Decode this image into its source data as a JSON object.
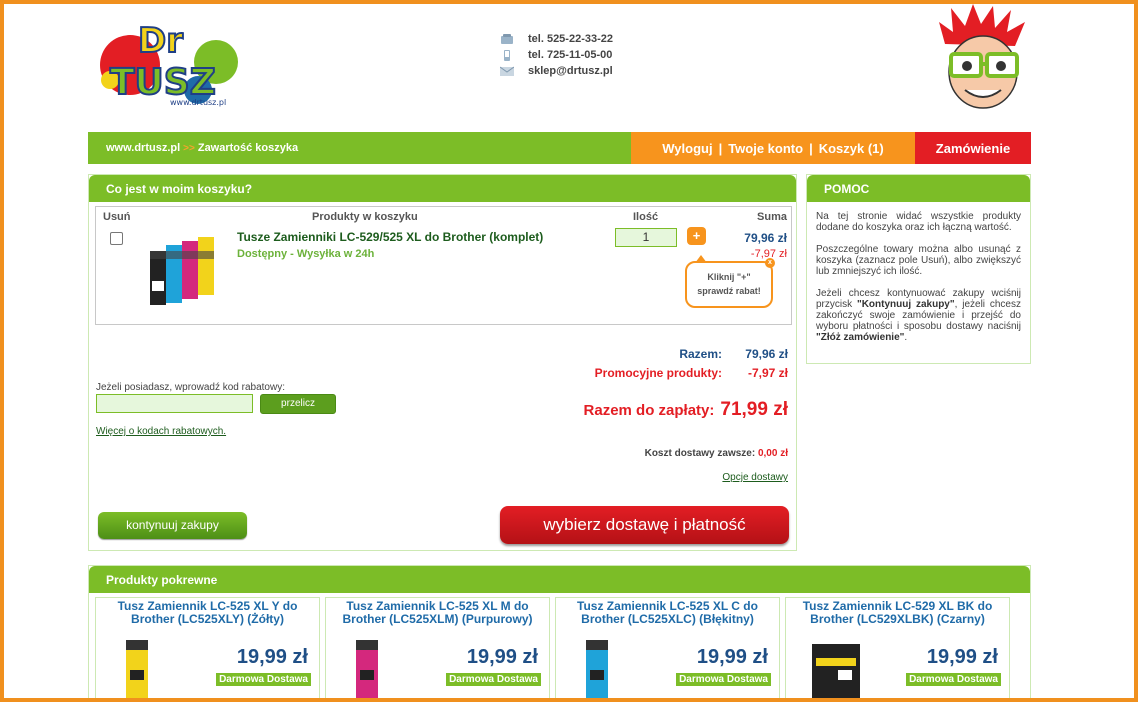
{
  "header": {
    "logo_text": "DrTUSZ",
    "logo_url_text": "www.drtusz.pl",
    "contacts": [
      {
        "icon": "phone-icon",
        "text": "tel. 525-22-33-22"
      },
      {
        "icon": "mobile-icon",
        "text": "tel. 725-11-05-00"
      },
      {
        "icon": "mail-icon",
        "text": "sklep@drtusz.pl"
      }
    ]
  },
  "nav": {
    "breadcrumb_home": "www.drtusz.pl",
    "breadcrumb_sep": ">>",
    "breadcrumb_current": "Zawartość koszyka",
    "logout": "Wyloguj",
    "sep1": "|",
    "account": "Twoje konto",
    "sep2": "|",
    "cart": "Koszyk (1)",
    "order": "Zamówienie"
  },
  "cart": {
    "title": "Co jest w moim koszyku?",
    "headers": {
      "remove": "Usuń",
      "products": "Produkty w koszyku",
      "qty": "Ilość",
      "sum": "Suma"
    },
    "item": {
      "name": "Tusze Zamienniki LC-529/525 XL do Brother (komplet)",
      "availability": "Dostępny - Wysyłka w 24h",
      "qty": "1",
      "plus": "+",
      "price": "79,96 zł",
      "discount": "-7,97 zł"
    },
    "bubble": {
      "line1": "Kliknij \"+\"",
      "line2": "sprawdź rabat!",
      "close": "x"
    },
    "summary": {
      "subtotal_label": "Razem:",
      "subtotal_value": "79,96 zł",
      "promo_label": "Promocyjne produkty:",
      "promo_value": "-7,97 zł",
      "total_label": "Razem do zapłaty:",
      "total_value": "71,99 zł",
      "shipping_label": "Koszt dostawy zawsze:",
      "shipping_value": "0,00 zł",
      "shipping_options": "Opcje dostawy"
    },
    "coupon": {
      "label": "Jeżeli posiadasz, wprowadź kod rabatowy:",
      "value": "",
      "button": "przelicz",
      "more_link": "Więcej o kodach rabatowych."
    },
    "continue_button": "kontynuuj zakupy",
    "order_button": "wybierz dostawę i płatność"
  },
  "help": {
    "title": "POMOC",
    "p1": "Na tej stronie widać wszystkie produkty dodane do koszyka oraz ich łączną wartość.",
    "p2": "Poszczególne towary można albo usunąć z koszyka (zaznacz pole Usuń), albo zwiększyć lub zmniejszyć ich ilość.",
    "p3_a": "Jeżeli chcesz kontynuować zakupy wciśnij przycisk ",
    "p3_b": "\"Kontynuuj zakupy\"",
    "p3_c": ", jeżeli chcesz zakończyć swoje zamówienie i przejść do wyboru płatności i sposobu dostawy naciśnij ",
    "p3_d": "\"Złóż zamówienie\"",
    "p3_e": "."
  },
  "related": {
    "title": "Produkty pokrewne",
    "items": [
      {
        "name": "Tusz Zamiennik LC-525 XL Y do Brother (LC525XLY) (Żółty)",
        "price": "19,99 zł",
        "badge": "Darmowa Dostawa",
        "color": "#f2d31b"
      },
      {
        "name": "Tusz Zamiennik LC-525 XL M do Brother (LC525XLM) (Purpurowy)",
        "price": "19,99 zł",
        "badge": "Darmowa Dostawa",
        "color": "#d4287d"
      },
      {
        "name": "Tusz Zamiennik LC-525 XL C do Brother (LC525XLC) (Błękitny)",
        "price": "19,99 zł",
        "badge": "Darmowa Dostawa",
        "color": "#1fa3d9"
      },
      {
        "name": "Tusz Zamiennik LC-529 XL BK do Brother (LC529XLBK) (Czarny)",
        "price": "19,99 zł",
        "badge": "Darmowa Dostawa",
        "color": "#222222"
      }
    ]
  },
  "colors": {
    "green": "#7cbd27",
    "orange": "#f7941d",
    "red": "#e31e24",
    "blue": "#1f4f86"
  }
}
